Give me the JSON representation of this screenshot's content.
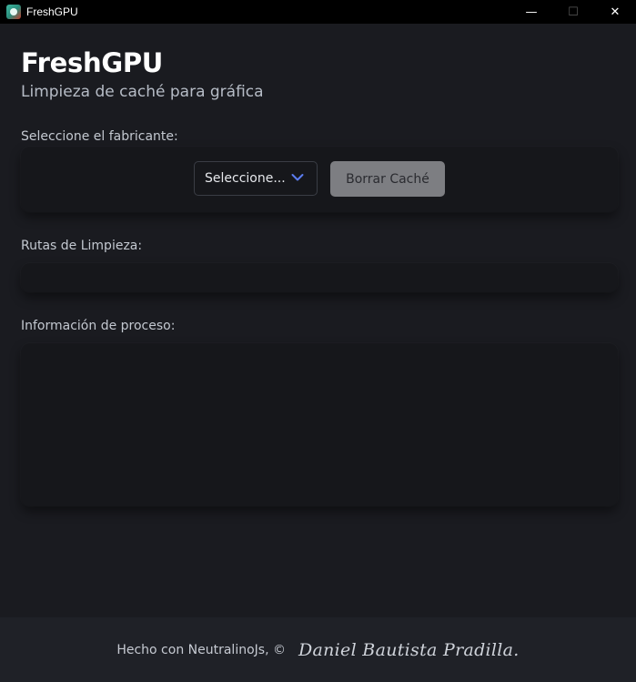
{
  "window": {
    "title": "FreshGPU",
    "minimize_glyph": "—",
    "maximize_glyph": "☐",
    "close_glyph": "✕"
  },
  "header": {
    "title": "FreshGPU",
    "subtitle": "Limpieza de caché para gráfica"
  },
  "manufacturer": {
    "label": "Seleccione el fabricante:",
    "select_value": "Seleccione...",
    "clear_button": "Borrar Caché"
  },
  "paths": {
    "label": "Rutas de Limpieza:",
    "content": ""
  },
  "process": {
    "label": "Información de proceso:",
    "content": ""
  },
  "footer": {
    "text": "Hecho con NeutralinoJs, ©",
    "signature": "Daniel Bautista Pradilla."
  },
  "colors": {
    "accent_chevron": "#5b7cf0",
    "background": "#1a1b20"
  }
}
